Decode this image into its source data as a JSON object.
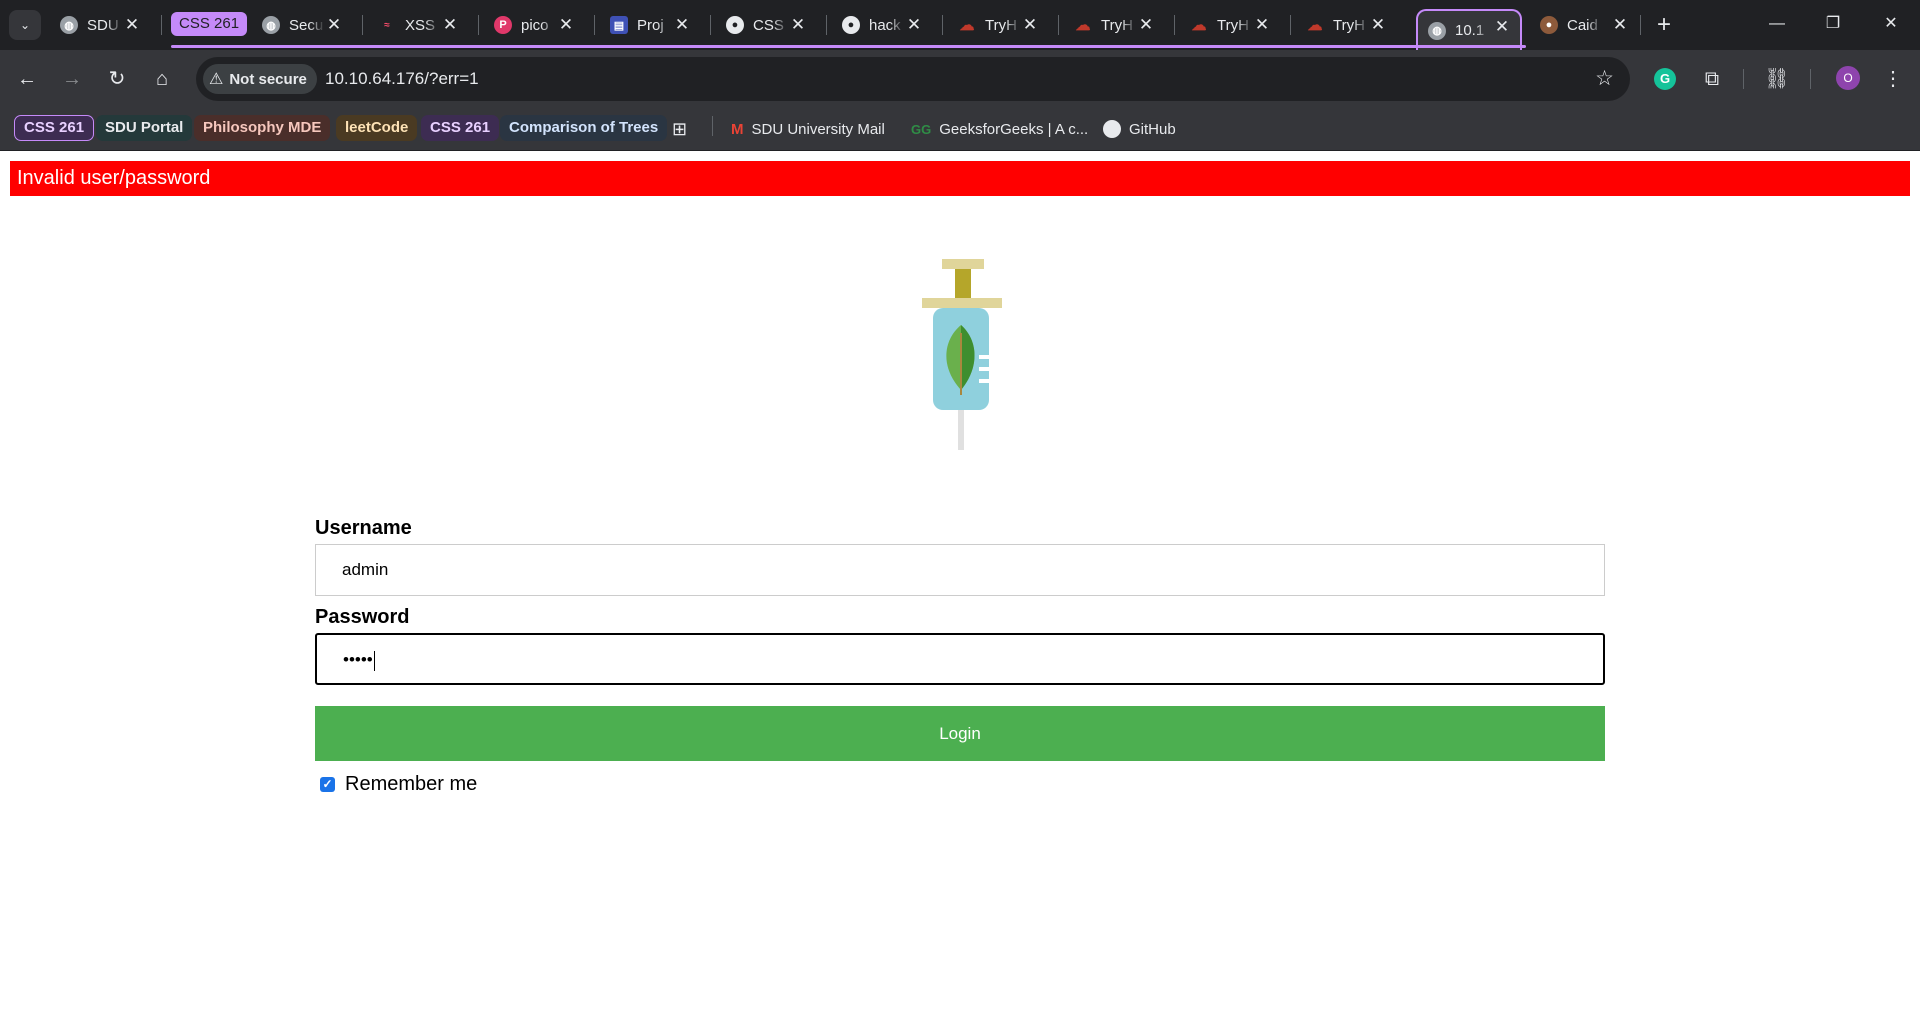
{
  "browser": {
    "tabs": [
      {
        "title": "SDU",
        "icon": "globe-icon"
      },
      {
        "title": "CSS 261",
        "icon": "tab-group-chip"
      },
      {
        "title": "Secu",
        "icon": "globe-icon"
      },
      {
        "title": "XSS",
        "icon": "xss-icon"
      },
      {
        "title": "pico",
        "icon": "picoctf-icon"
      },
      {
        "title": "Proj",
        "icon": "project-icon"
      },
      {
        "title": "CSS",
        "icon": "github-icon"
      },
      {
        "title": "hack",
        "icon": "github-icon"
      },
      {
        "title": "TryH",
        "icon": "tryhackme-icon"
      },
      {
        "title": "TryH",
        "icon": "tryhackme-icon"
      },
      {
        "title": "TryH",
        "icon": "tryhackme-icon"
      },
      {
        "title": "TryH",
        "icon": "tryhackme-icon"
      },
      {
        "title": "10.1",
        "icon": "globe-icon",
        "active": true
      },
      {
        "title": "Caid",
        "icon": "cookie-icon"
      }
    ],
    "tab_group_color": "#c58af9",
    "security_label": "Not secure",
    "url": "10.10.64.176/?err=1",
    "profile_initial": "O",
    "bookmarks": [
      {
        "label": "CSS 261",
        "kind": "chip",
        "bg": "#3d2c52",
        "fg": "#e8d0ff",
        "border": "#c58af9"
      },
      {
        "label": "SDU Portal",
        "kind": "chip",
        "bg": "#24393a",
        "fg": "#e8eaed"
      },
      {
        "label": "Philosophy MDE",
        "kind": "chip",
        "bg": "#4a2e2a",
        "fg": "#f6c7bd"
      },
      {
        "label": "leetCode",
        "kind": "chip",
        "bg": "#4a3a22",
        "fg": "#fde2b5"
      },
      {
        "label": "CSS 261",
        "kind": "chip",
        "bg": "#3d2c52",
        "fg": "#e8d0ff"
      },
      {
        "label": "Comparison of Trees",
        "kind": "chip",
        "bg": "#2a3542",
        "fg": "#d2e3fc"
      },
      {
        "label": "SDU University Mail",
        "kind": "link",
        "icon": "gmail-icon"
      },
      {
        "label": "GeeksforGeeks | A c...",
        "kind": "link",
        "icon": "geeksforgeeks-icon"
      },
      {
        "label": "GitHub",
        "kind": "link",
        "icon": "github-icon"
      }
    ]
  },
  "page": {
    "error_message": "Invalid user/password",
    "error_color": "#ff0000",
    "username_label": "Username",
    "username_value": "admin",
    "password_label": "Password",
    "password_value": "•••••",
    "login_label": "Login",
    "login_color": "#4caf50",
    "remember_label": "Remember me",
    "remember_checked": true
  }
}
